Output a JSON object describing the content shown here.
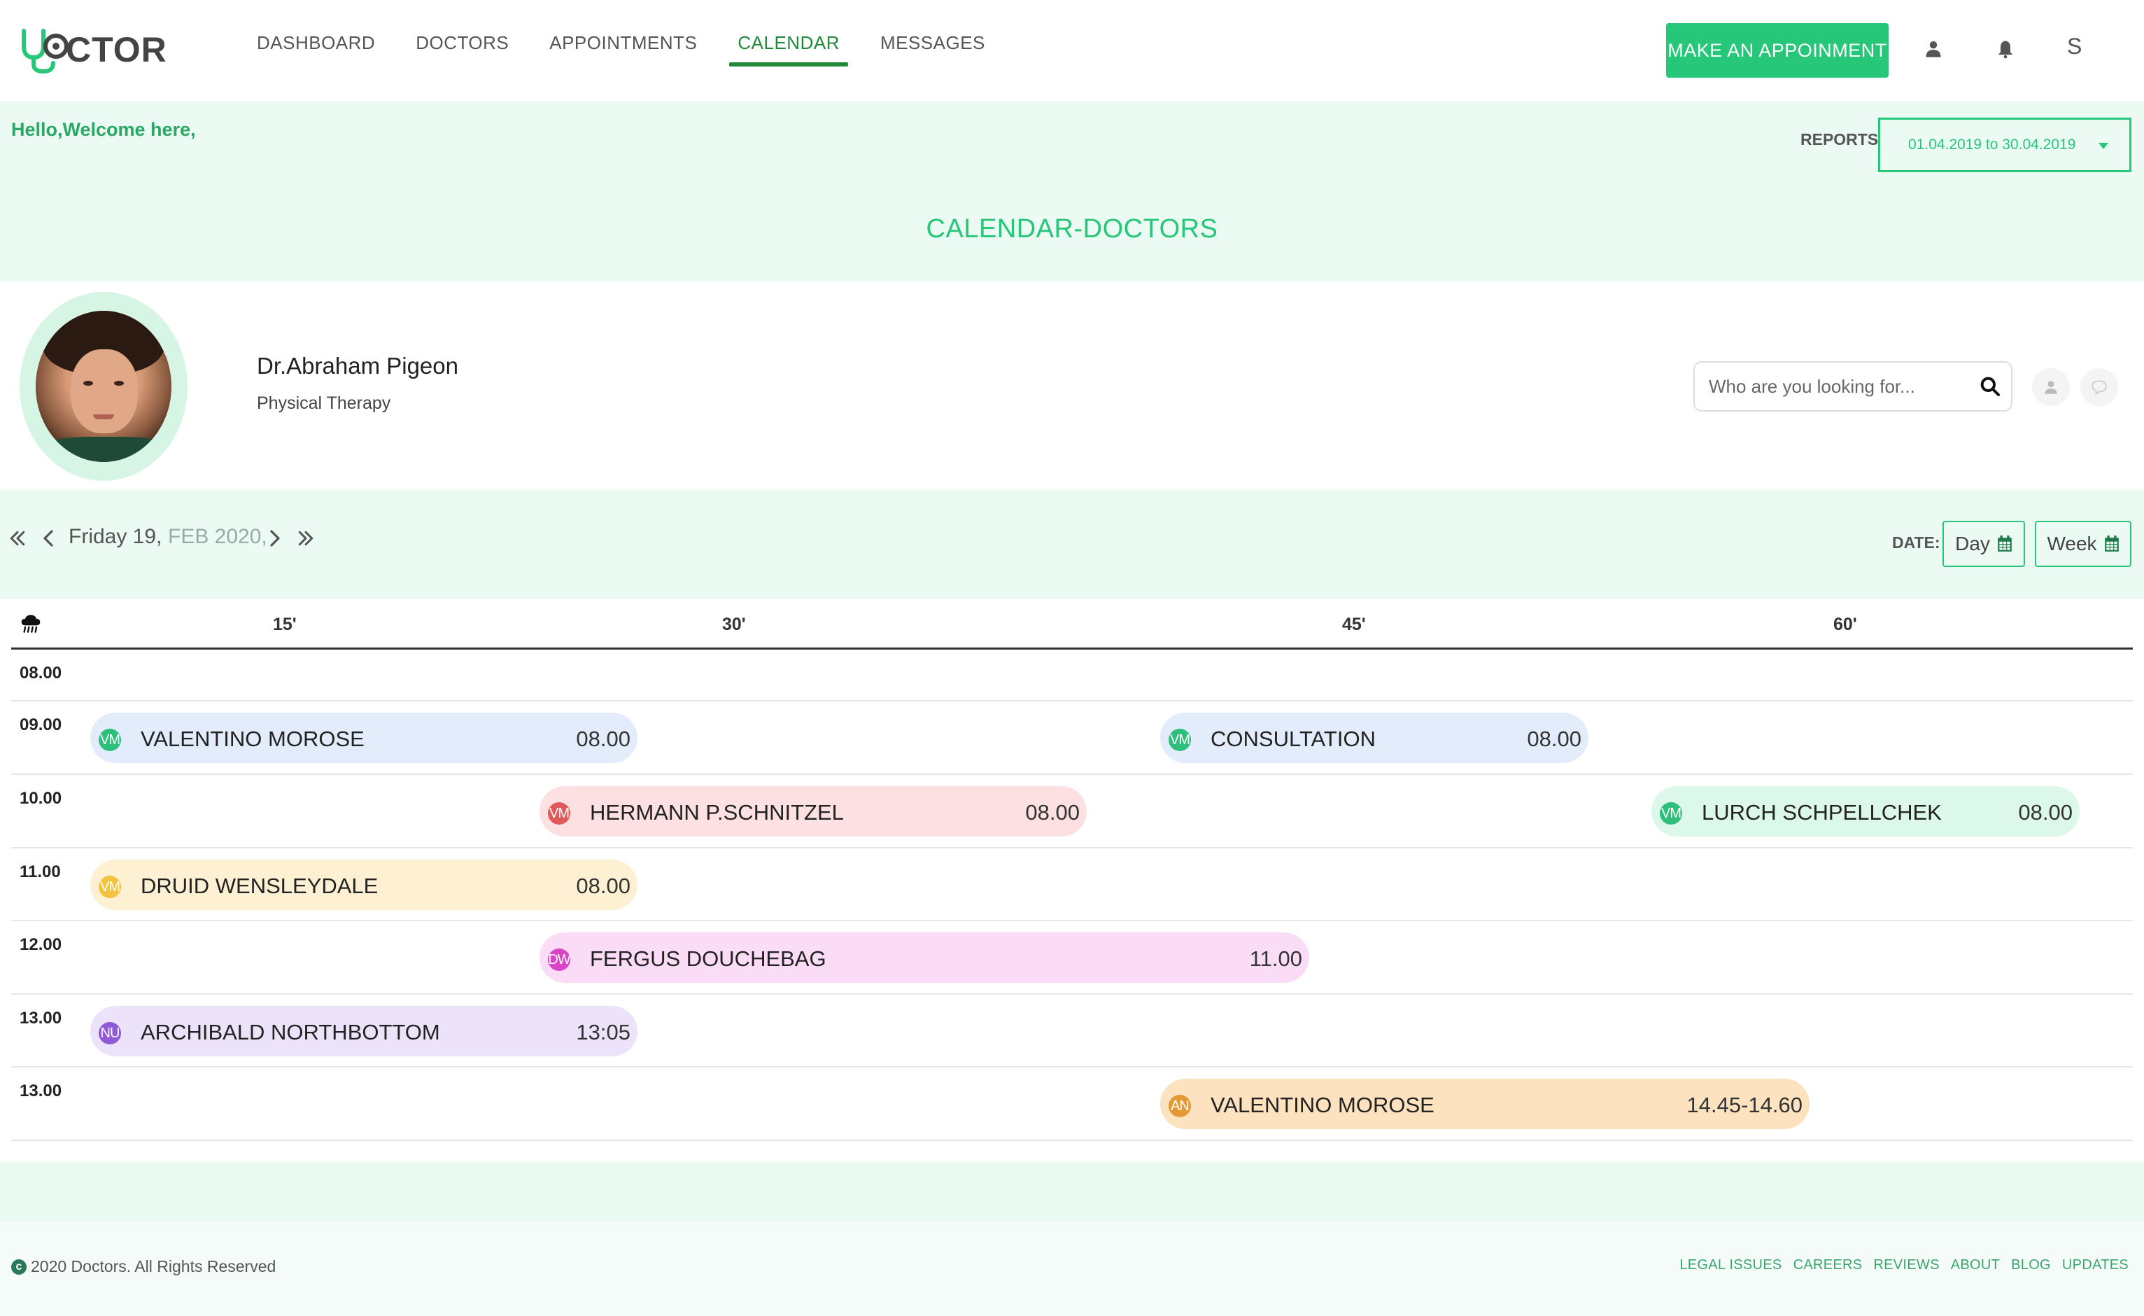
{
  "brand": {
    "logo_text": "CTOR",
    "accent": "#27c77a",
    "nav_active": "#1e8a3a"
  },
  "nav": {
    "items": [
      {
        "label": "DASHBOARD",
        "active": false
      },
      {
        "label": "DOCTORS",
        "active": false
      },
      {
        "label": "APPOINTMENTS",
        "active": false
      },
      {
        "label": "CALENDAR",
        "active": true
      },
      {
        "label": "MESSAGES",
        "active": false
      }
    ]
  },
  "header": {
    "cta_label": "MAKE AN APPOINMENT",
    "icons": [
      "user-icon",
      "bell-icon"
    ],
    "user_initial": "S"
  },
  "welcome": {
    "text": "Hello,Welcome here,",
    "reports_label": "REPORTS:",
    "reports_range": "01.04.2019 to 30.04.2019"
  },
  "page": {
    "title": "CALENDAR-DOCTORS"
  },
  "doctor": {
    "name": "Dr.Abraham Pigeon",
    "specialty": "Physical Therapy"
  },
  "search": {
    "placeholder": "Who are you looking for..."
  },
  "date_nav": {
    "day": "Friday 19,",
    "month": "FEB 2020,",
    "date_label": "DATE:",
    "view_day": "Day",
    "view_week": "Week"
  },
  "calendar": {
    "columns": [
      "15'",
      "30'",
      "45'",
      "60'"
    ],
    "rows": [
      {
        "time": "08.00",
        "appointments": []
      },
      {
        "time": "09.00",
        "appointments": [
          {
            "initials": "VM",
            "name": "VALENTINO MOROSE",
            "time": "08.00",
            "color": "#e2ecfb",
            "badge": "#2ec07a"
          },
          {
            "initials": "VM",
            "name": "CONSULTATION",
            "time": "08.00",
            "color": "#e2ecfb",
            "badge": "#2ec07a"
          }
        ]
      },
      {
        "time": "10.00",
        "appointments": [
          {
            "initials": "VM",
            "name": "HERMANN P.SCHNITZEL",
            "time": "08.00",
            "color": "#fde0e2",
            "badge": "#e05a5a"
          },
          {
            "initials": "VM",
            "name": "LURCH SCHPELLCHEK",
            "time": "08.00",
            "color": "#dcf8ea",
            "badge": "#2ec07a"
          }
        ]
      },
      {
        "time": "11.00",
        "appointments": [
          {
            "initials": "VM",
            "name": "DRUID WENSLEYDALE",
            "time": "08.00",
            "color": "#fdf0d3",
            "badge": "#f2c440"
          }
        ]
      },
      {
        "time": "12.00",
        "appointments": [
          {
            "initials": "DW",
            "name": "FERGUS DOUCHEBAG",
            "time": "11.00",
            "color": "#fbdcf6",
            "badge": "#d846c7"
          }
        ]
      },
      {
        "time": "13.00",
        "appointments": [
          {
            "initials": "NU",
            "name": "ARCHIBALD NORTHBOTTOM",
            "time": "13:05",
            "color": "#ece3fa",
            "badge": "#8e5ad8"
          }
        ]
      },
      {
        "time": "13.00",
        "appointments": [
          {
            "initials": "AN",
            "name": "VALENTINO MOROSE",
            "time": "14.45-14.60",
            "color": "#fde2c0",
            "badge": "#e39a35"
          }
        ]
      }
    ]
  },
  "footer": {
    "copyright": "2020 Doctors. All Rights Reserved",
    "links": [
      "LEGAL ISSUES",
      "CAREERS",
      "REVIEWS",
      "ABOUT",
      "BLOG",
      "UPDATES"
    ]
  }
}
